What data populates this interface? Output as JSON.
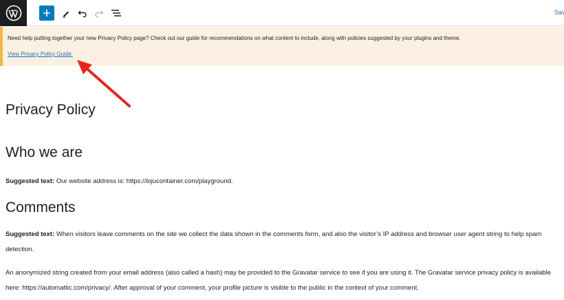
{
  "toolbar": {
    "save_label": "Sav",
    "icons": [
      "wordpress-logo",
      "add-block",
      "edit-pen",
      "undo",
      "redo",
      "document-outline"
    ],
    "accent": "#007cba"
  },
  "notice": {
    "text": "Need help putting together your new Privacy Policy page? Check out our guide for recommendations on what content to include, along with policies suggested by your plugins and theme.",
    "link": "View Privacy Policy Guide.",
    "bg": "#fcf0e3",
    "border": "#f0b849"
  },
  "content": {
    "page_title": "Privacy Policy",
    "section_who": "Who we are",
    "who_label": "Suggested text:",
    "who_text": " Our website address is: https://lojucontainer.com/playground.",
    "section_comments": "Comments",
    "comments_label": "Suggested text:",
    "comments_text": " When visitors leave comments on the site we collect the data shown in the comments form, and also the visitor’s IP address and browser user agent string to help spam detection.",
    "gravatar_text": "An anonymized string created from your email address (also called a hash) may be provided to the Gravatar service to see if you are using it. The Gravatar service privacy policy is available here: https://automattic.com/privacy/. After approval of your comment, your profile picture is visible to the public in the context of your comment."
  },
  "annotation": {
    "arrow_color": "#e8261d"
  }
}
